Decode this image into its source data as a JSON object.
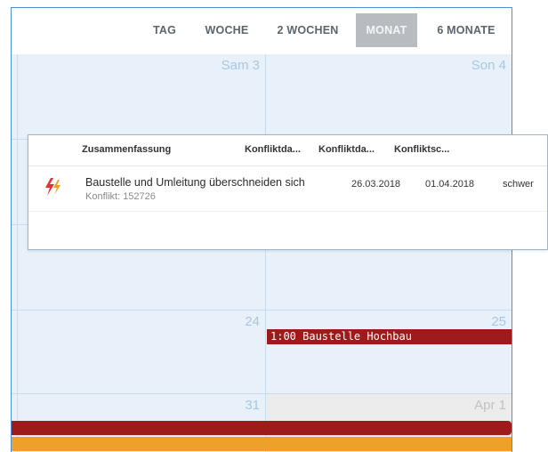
{
  "toolbar": {
    "views": [
      "TAG",
      "WOCHE",
      "2 WOCHEN",
      "MONAT",
      "6 MONATE"
    ],
    "active_view": "MONAT"
  },
  "calendar": {
    "days": {
      "sat3": "Sam 3",
      "sun4": "Son 4",
      "d24": "24",
      "d25": "25",
      "d31": "31",
      "apr1": "Apr 1"
    },
    "event_label": "1:00 Baustelle Hochbau"
  },
  "popup": {
    "columns": [
      "Zusammenfassung",
      "Konfliktda...",
      "Konfliktda...",
      "Konfliktsc..."
    ],
    "row": {
      "title": "Baustelle und Umleitung überschneiden sich",
      "subtitle": "Konflikt: 152726",
      "start": "26.03.2018",
      "end": "01.04.2018",
      "severity": "schwer",
      "icon": "conflict-lightning-icon"
    }
  },
  "colors": {
    "event_red": "#9c1b1b",
    "event_orange": "#eea12a",
    "cell_blue": "#e8f1f9",
    "active_tab": "#b8bcc0"
  }
}
